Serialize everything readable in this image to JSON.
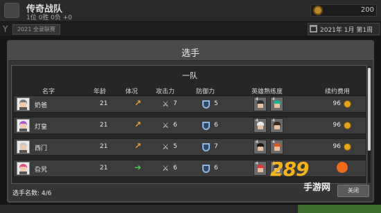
{
  "background": {
    "team_name": "传奇战队",
    "team_record": "1位 0胜 0负 +0",
    "coins": "200",
    "league": "2021 全录联赛",
    "date": "2021年 1月 第1周"
  },
  "modal": {
    "title": "选手",
    "section_title": "一队",
    "columns": {
      "name": "名字",
      "age": "年龄",
      "condition": "体况",
      "attack": "攻击力",
      "defense": "防御力",
      "hero_mastery": "英雄熟练度",
      "contract_fee": "续约费用"
    },
    "players": [
      {
        "name": "奶爸",
        "age": "21",
        "condition": "↗",
        "condition_color": "#f0a030",
        "attack": "7",
        "defense": "5",
        "fee": "96",
        "hair": "#7a7a7a",
        "heroes": [
          {
            "hair": "#2f2f2f",
            "lv": "4"
          },
          {
            "hair": "#1fb08a",
            "lv": "4"
          }
        ]
      },
      {
        "name": "灯皇",
        "age": "21",
        "condition": "↗",
        "condition_color": "#f0a030",
        "attack": "6",
        "defense": "6",
        "fee": "96",
        "hair": "#b05bd6",
        "heroes": [
          {
            "hair": "#e6e6e6",
            "lv": "4"
          },
          {
            "hair": "#3a2a1a",
            "lv": "4"
          }
        ]
      },
      {
        "name": "西门",
        "age": "21",
        "condition": "↗",
        "condition_color": "#f0a030",
        "attack": "5",
        "defense": "7",
        "fee": "96",
        "hair": "#c9c9c9",
        "heroes": [
          {
            "hair": "#1a1a1a",
            "lv": "4"
          },
          {
            "hair": "#d65a2a",
            "lv": "4"
          }
        ]
      },
      {
        "name": "旮旯",
        "age": "21",
        "condition": "➜",
        "condition_color": "#3fcf4a",
        "attack": "6",
        "defense": "6",
        "fee": "",
        "hair": "#e84a8a",
        "heroes": [
          {
            "hair": "#d83a3a",
            "lv": "4"
          },
          {
            "hair": "#3a3a3a",
            "lv": "4"
          }
        ]
      }
    ],
    "player_count": "选手名数: 4/6",
    "close_label": "关闭"
  },
  "watermark": {
    "big": "289",
    "small": "手游网"
  },
  "icons": {
    "condition": "arrow-icon",
    "attack": "sword-icon",
    "defense": "shield-icon",
    "fee": "coin-icon"
  }
}
